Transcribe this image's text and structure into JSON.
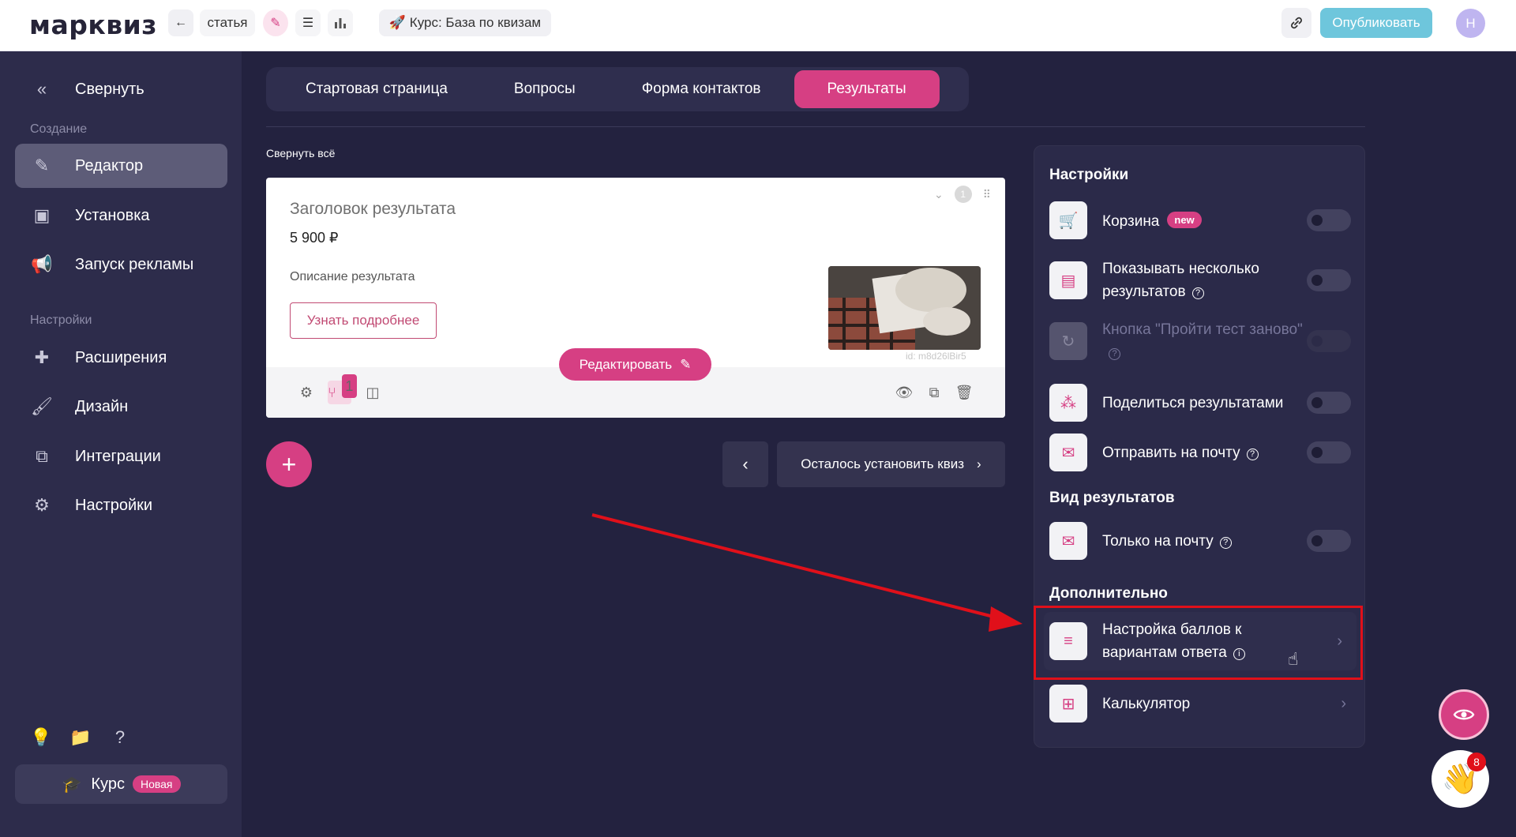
{
  "topbar": {
    "logo": "марквиз",
    "articles_label": "статья",
    "course_label": "🚀 Курс: База по квизам",
    "publish_label": "Опубликовать",
    "avatar_initial": "Н"
  },
  "sidebar": {
    "collapse_label": "Свернуть",
    "section_create": "Создание",
    "section_settings": "Настройки",
    "items": [
      {
        "label": "Редактор"
      },
      {
        "label": "Установка"
      },
      {
        "label": "Запуск рекламы"
      },
      {
        "label": "Расширения"
      },
      {
        "label": "Дизайн"
      },
      {
        "label": "Интеграции"
      },
      {
        "label": "Настройки"
      }
    ],
    "course_label": "Курс",
    "course_badge": "Новая"
  },
  "tabs": [
    {
      "label": "Стартовая страница"
    },
    {
      "label": "Вопросы"
    },
    {
      "label": "Форма контактов"
    },
    {
      "label": "Результаты"
    }
  ],
  "collapse_all_label": "Свернуть всё",
  "result_card": {
    "title": "Заголовок результата",
    "price": "5 900 ₽",
    "description": "Описание результата",
    "more_button": "Узнать подробнее",
    "id_text": "id: m8d26lBir5",
    "number": "1",
    "branch_badge": "1",
    "edit_button": "Редактировать"
  },
  "nav": {
    "next_label": "Осталось установить квиз"
  },
  "panel": {
    "settings_heading": "Настройки",
    "cart_label": "Корзина",
    "cart_badge": "new",
    "multi_results_label": "Показывать несколько результатов",
    "retake_label": "Кнопка \"Пройти тест заново\"",
    "share_label": "Поделиться результатами",
    "email_label": "Отправить на почту",
    "view_heading": "Вид результатов",
    "email_only_label": "Только на почту",
    "extra_heading": "Дополнительно",
    "scores_label": "Настройка баллов к вариантам ответа",
    "calculator_label": "Калькулятор"
  },
  "fab": {
    "notifications_count": "8"
  },
  "colors": {
    "accent": "#d63f83",
    "publish": "#6ec6dc",
    "background": "#23223f",
    "sidebar": "#2d2c4b",
    "highlight": "#e0101a"
  }
}
